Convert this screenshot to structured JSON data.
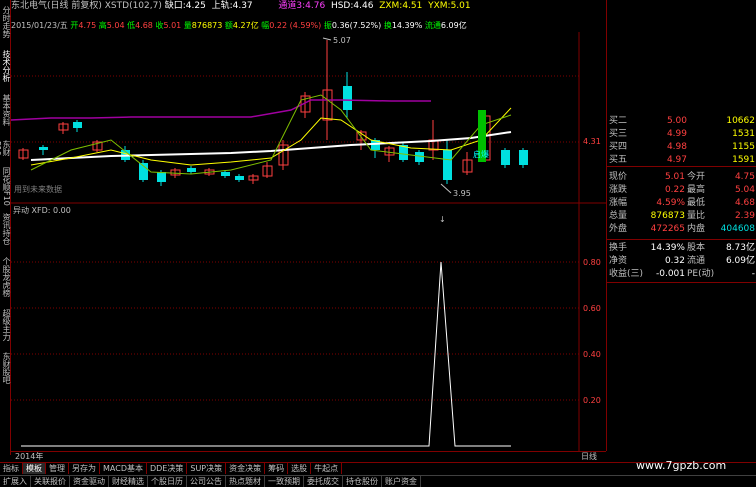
{
  "vertical_tabs": [
    "分时走势",
    "技术分析",
    "基本资料",
    "东财F10",
    "同花顺F10",
    "资讯持仓",
    "个股龙虎榜",
    "超级主力",
    "东财股吧"
  ],
  "title": {
    "stock": "东北电气(日线 前复权)",
    "indicator": "XSTD(102,7)",
    "gap_label": "缺口:",
    "gap_value": "4.25",
    "rail_label": "上轨:",
    "rail_value": "4.37",
    "channel3_label": "通道3:",
    "channel3_value": "4.76",
    "hsd_label": "HSD:",
    "hsd_value": "4.46",
    "zxm_label": "ZXM:",
    "zxm_value": "4.51",
    "yxm_label": "YXM:",
    "yxm_value": "5.01"
  },
  "info": {
    "date": "2015/01/23/五",
    "open_label": "开",
    "open": "4.75",
    "high_label": "高",
    "high": "5.04",
    "low_label": "低",
    "low": "4.68",
    "close_label": "收",
    "close": "5.01",
    "vol_label": "量",
    "vol": "876873",
    "amt_label": "额",
    "amt": "4.27亿",
    "amp_label": "幅",
    "amp": "0.22 (4.59%)",
    "swing_label": "振",
    "swing": "0.36(7.52%)",
    "turn_label": "换",
    "turn": "14.39%",
    "flow_label": "流通",
    "flow": "6.09亿"
  },
  "chart_annotations": {
    "high_mark": "5.07",
    "low_mark": "3.95",
    "price_tick": "4.31",
    "note": "用到未来数据",
    "signal": "启爆"
  },
  "indicator_panel": {
    "label": "异动 XFD: 0.00",
    "ticks": [
      "0.80",
      "0.60",
      "0.40",
      "0.20"
    ]
  },
  "chart_data": {
    "type": "line",
    "series": [
      {
        "values": [
          0,
          0,
          0,
          0,
          0,
          0,
          0,
          0,
          0,
          0,
          0,
          0,
          0,
          0,
          0,
          0,
          0,
          0,
          0,
          0,
          0,
          0,
          0,
          0,
          0,
          0,
          0,
          0,
          0,
          0,
          0,
          0,
          0,
          0,
          1,
          0,
          0,
          0,
          0,
          0,
          0
        ]
      }
    ],
    "ylim": [
      0,
      1
    ]
  },
  "axis": {
    "year": "2014年",
    "period": "日线"
  },
  "quotes": {
    "levels": [
      {
        "label": "买二",
        "price": "5.00",
        "vol": "10662"
      },
      {
        "label": "买三",
        "price": "4.99",
        "vol": "1531"
      },
      {
        "label": "买四",
        "price": "4.98",
        "vol": "1155"
      },
      {
        "label": "买五",
        "price": "4.97",
        "vol": "1591"
      }
    ],
    "stats": [
      {
        "l1": "现价",
        "v1": "5.01",
        "l2": "今开",
        "v2": "4.75",
        "c1": "red",
        "c2": "red"
      },
      {
        "l1": "涨跌",
        "v1": "0.22",
        "l2": "最高",
        "v2": "5.04",
        "c1": "red",
        "c2": "red"
      },
      {
        "l1": "涨幅",
        "v1": "4.59%",
        "l2": "最低",
        "v2": "4.68",
        "c1": "red",
        "c2": "red"
      },
      {
        "l1": "总量",
        "v1": "876873",
        "l2": "量比",
        "v2": "2.39",
        "c1": "yellow",
        "c2": "red"
      },
      {
        "l1": "外盘",
        "v1": "472265",
        "l2": "内盘",
        "v2": "404608",
        "c1": "red",
        "c2": "green"
      }
    ],
    "extra": [
      {
        "l1": "换手",
        "v1": "14.39%",
        "l2": "股本",
        "v2": "8.73亿",
        "c1": "white",
        "c2": "white"
      },
      {
        "l1": "净资",
        "v1": "0.32",
        "l2": "流通",
        "v2": "6.09亿",
        "c1": "white",
        "c2": "white"
      },
      {
        "l1": "收益(三)",
        "v1": "-0.001",
        "l2": "PE(动)",
        "v2": "-",
        "c1": "white",
        "c2": "white"
      }
    ]
  },
  "bottom_tabs": [
    "指标",
    "模板",
    "管理",
    "另存为",
    "MACD基本",
    "DDE决策",
    "SUP决策",
    "资金决策",
    "筹码",
    "选股",
    "牛起点"
  ],
  "foot_items": [
    "扩展入",
    "关联报价",
    "资金驱动",
    "财经精选",
    "个股日历",
    "公司公告",
    "热点题材",
    "一致预期",
    "委托成交",
    "持仓股份",
    "账户资金"
  ],
  "watermark": "www.7gpzb.com",
  "colors": {
    "up": "#ff4040",
    "down": "#00e0e0",
    "grid": "#800000",
    "ma_white": "#ffffff",
    "ma_yellow": "#ffff00",
    "ma_magenta": "#c000c0"
  }
}
